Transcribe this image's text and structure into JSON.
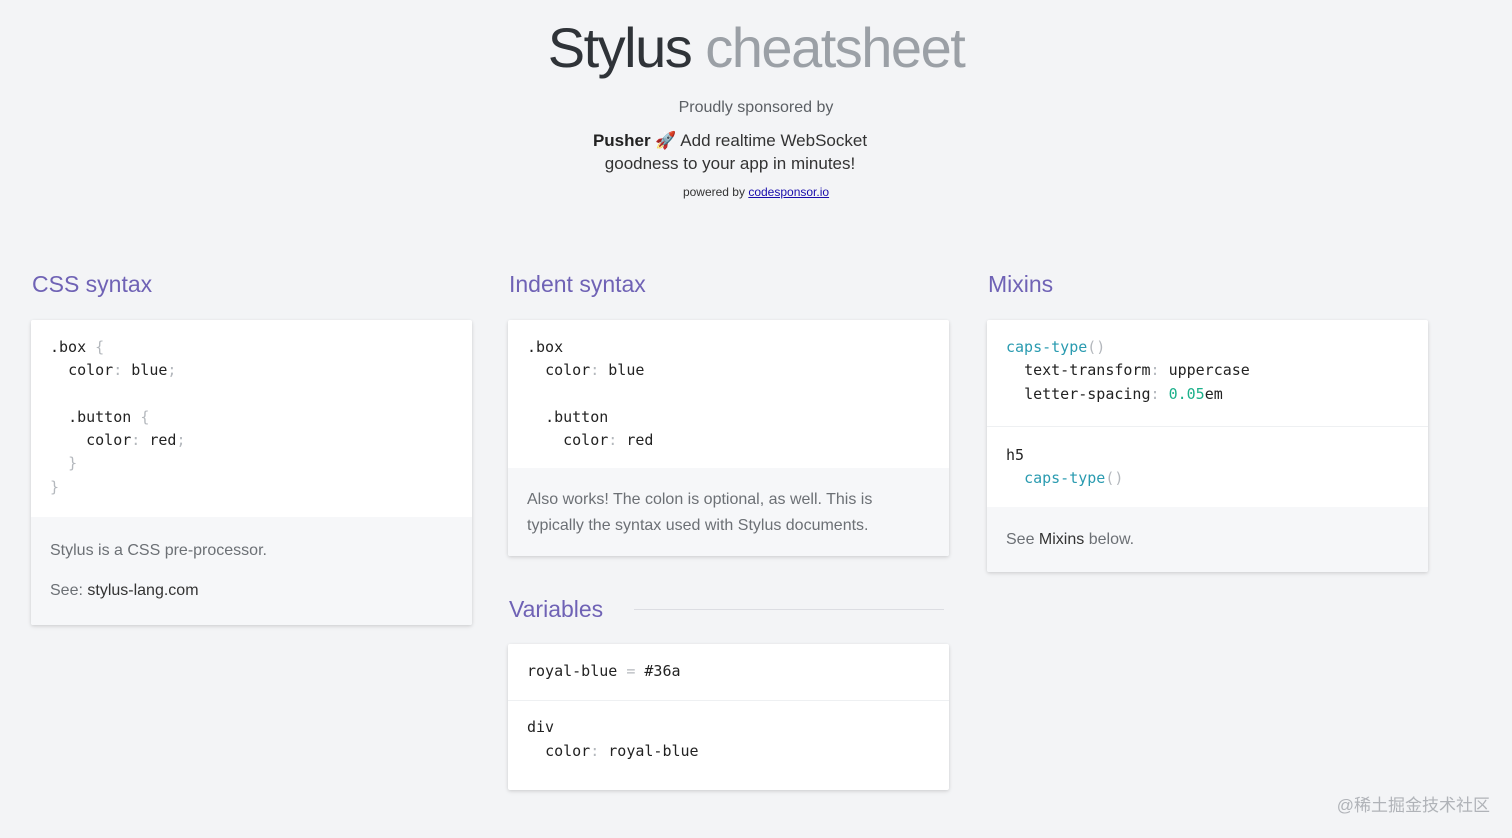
{
  "header": {
    "title_main": "Stylus",
    "title_sub": "cheatsheet",
    "sponsored_label": "Proudly sponsored by",
    "sponsor_name": "Pusher",
    "sponsor_emoji": "🚀",
    "sponsor_text": "Add realtime WebSocket goodness to your app in minutes!",
    "powered_label": "powered by",
    "powered_link": "codesponsor.io"
  },
  "sections": {
    "css_syntax": {
      "title": "CSS syntax",
      "code": [
        {
          "sel": ".box",
          "brace": "{"
        },
        {
          "prop": "color",
          "val": "blue"
        },
        {
          "sel": ".button",
          "brace": "{"
        },
        {
          "prop": "color",
          "val": "red"
        },
        {
          "close": "}"
        },
        {
          "close": "}"
        }
      ],
      "note_text": "Stylus is a CSS pre-processor.",
      "see_label": "See:",
      "see_link": "stylus-lang.com"
    },
    "indent_syntax": {
      "title": "Indent syntax",
      "code": [
        {
          "sel": ".box"
        },
        {
          "prop": "color",
          "val": "blue"
        },
        {
          "sel": ".button"
        },
        {
          "prop": "color",
          "val": "red"
        }
      ],
      "note_text": "Also works! The colon is optional, as well. This is typically the syntax used with Stylus documents."
    },
    "mixins": {
      "title": "Mixins",
      "code1": [
        {
          "func": "caps-type",
          "parens": "()"
        },
        {
          "prop": "text-transform",
          "val": "uppercase"
        },
        {
          "prop": "letter-spacing",
          "num": "0.05",
          "unit": "em"
        }
      ],
      "code2": [
        {
          "sel": "h5"
        },
        {
          "func": "caps-type",
          "parens": "()"
        }
      ],
      "note_see": "See",
      "note_link": "Mixins",
      "note_after": "below."
    },
    "variables": {
      "title": "Variables",
      "code1": {
        "name": "royal-blue",
        "op": "=",
        "val": "#36a"
      },
      "code2": [
        {
          "sel": "div"
        },
        {
          "prop": "color",
          "val": "royal-blue"
        }
      ]
    }
  },
  "colors": {
    "accent": "#6f62b5",
    "function": "#2a9bb0",
    "number": "#1bb08a",
    "background": "#f3f4f6"
  },
  "watermark": "@稀土掘金技术社区"
}
